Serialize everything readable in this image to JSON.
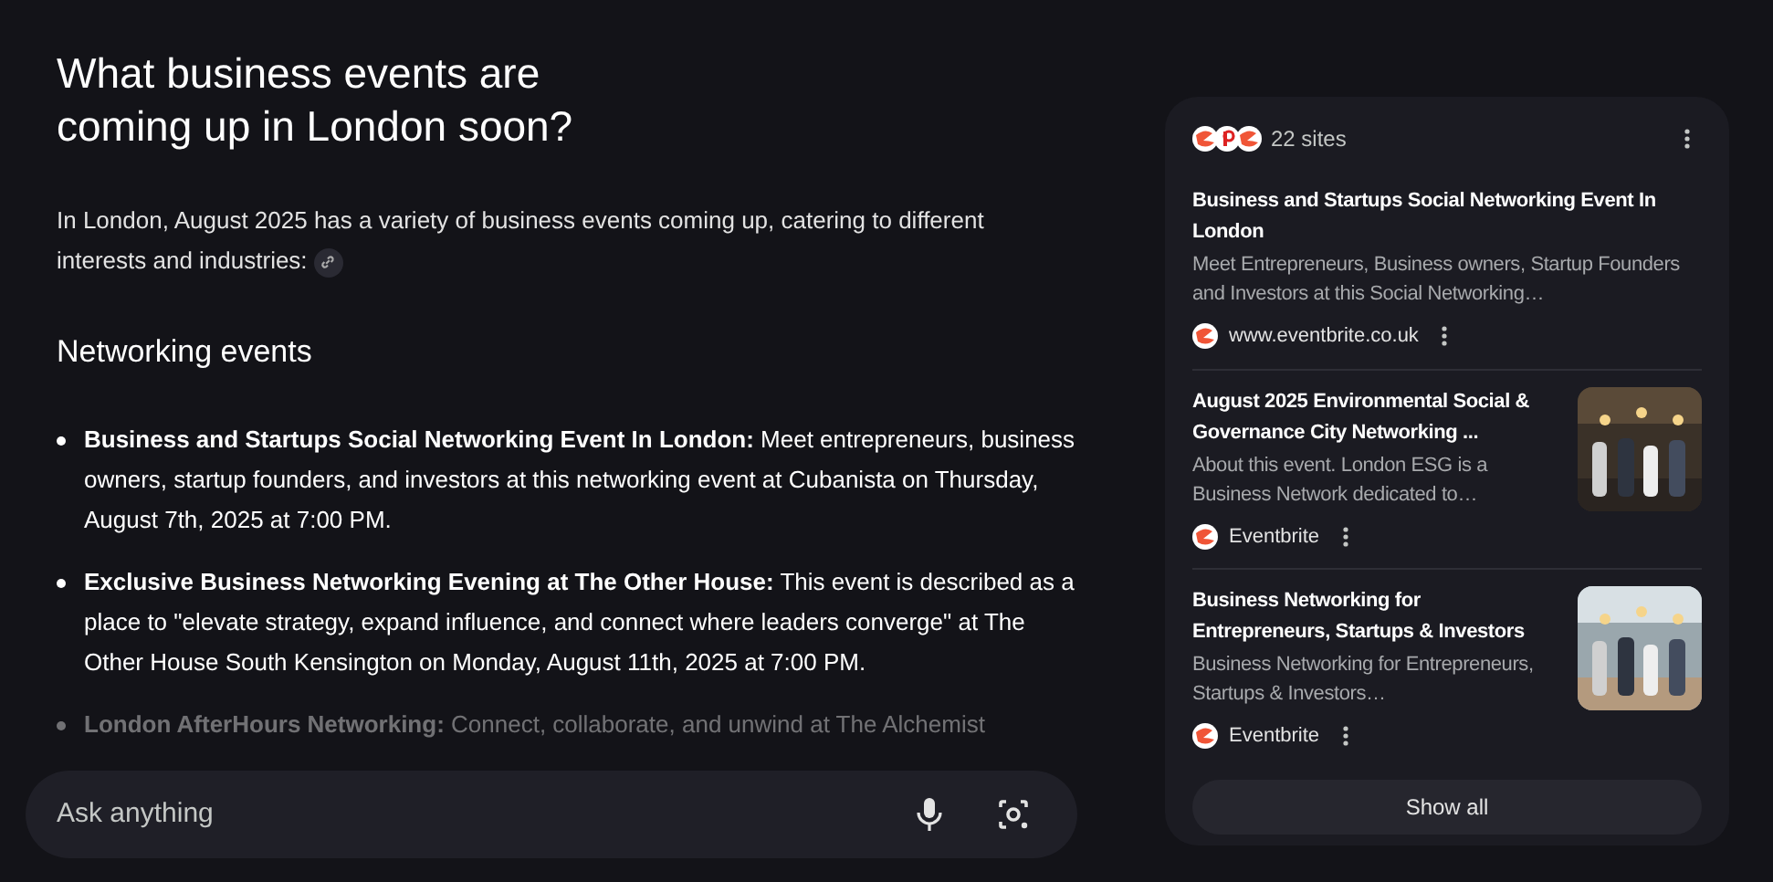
{
  "question": "What business events are coming up in London soon?",
  "intro": "In London, August 2025 has a variety of business events coming up, catering to different interests and industries:",
  "section_heading": "Networking events",
  "bullets": [
    {
      "text": "**Business and Startups Social Networking Event In London:** Meet entrepreneurs, business owners, startup founders, and investors at this networking event at Cubanista on Thursday, August 7th, 2025 at 7:00 PM.",
      "faded": false
    },
    {
      "text": "**Exclusive Business Networking Evening at The Other House:** This event is described as a place to \"elevate strategy, expand influence, and connect where leaders converge\" at The Other House South Kensington on Monday, August 11th, 2025 at 7:00 PM.",
      "faded": false
    },
    {
      "text": "**London AfterHours Networking:** Connect, collaborate, and unwind at The Alchemist",
      "faded": true
    }
  ],
  "ask_field": {
    "placeholder": "Ask anything"
  },
  "sources_panel": {
    "count": "22 sites",
    "results": [
      {
        "title": "Business and Startups Social Networking Event In London",
        "snippet": "Meet Entrepreneurs, Business owners, Startup Founders and Investors at this Social Networking…",
        "source": "www.eventbrite.co.uk"
      },
      {
        "title": "August 2025 Environmental Social & Governance City Networking ...",
        "snippet": "About this event. London ESG is a Business Network dedicated to…",
        "source": "Eventbrite"
      },
      {
        "title": "Business Networking for Entrepreneurs, Startups & Investors",
        "snippet": "Business Networking for Entrepreneurs, Startups & Investors…",
        "source": "Eventbrite"
      }
    ],
    "show_all": "Show all"
  }
}
